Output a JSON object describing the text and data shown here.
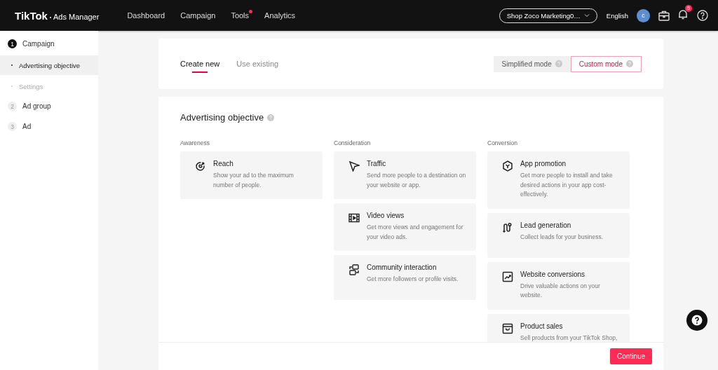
{
  "header": {
    "logo": "TikTok",
    "logo_suffix": "Ads Manager",
    "nav": [
      {
        "label": "Dashboard",
        "badge": false
      },
      {
        "label": "Campaign",
        "badge": false
      },
      {
        "label": "Tools",
        "badge": true
      },
      {
        "label": "Analytics",
        "badge": false
      }
    ],
    "account": "Shop Zoco Marketing0…",
    "language": "English",
    "avatar": "c",
    "notification_count": "5"
  },
  "sidebar": {
    "steps": [
      {
        "number": "1",
        "label": "Campaign",
        "active": true,
        "children": [
          {
            "label": "Advertising objective",
            "selected": true
          },
          {
            "label": "Settings",
            "selected": false
          }
        ]
      },
      {
        "number": "2",
        "label": "Ad group",
        "active": false
      },
      {
        "number": "3",
        "label": "Ad",
        "active": false
      }
    ]
  },
  "tabs": [
    {
      "label": "Create new",
      "selected": true
    },
    {
      "label": "Use existing",
      "selected": false
    }
  ],
  "modes": [
    {
      "label": "Simplified mode",
      "selected": false
    },
    {
      "label": "Custom mode",
      "selected": true
    }
  ],
  "objective": {
    "title": "Advertising objective",
    "groups": [
      {
        "title": "Awareness",
        "options": [
          {
            "title": "Reach",
            "description": "Show your ad to the maximum number of people."
          }
        ]
      },
      {
        "title": "Consideration",
        "options": [
          {
            "title": "Traffic",
            "description": "Send more people to a destination on your website or app."
          },
          {
            "title": "Video views",
            "description": "Get more views and engagement for your video ads."
          },
          {
            "title": "Community interaction",
            "description": "Get more followers or profile visits."
          }
        ]
      },
      {
        "title": "Conversion",
        "options": [
          {
            "title": "App promotion",
            "description": "Get more people to install and take desired actions in your app cost-effectively."
          },
          {
            "title": "Lead generation",
            "description": "Collect leads for your business."
          },
          {
            "title": "Website conversions",
            "description": "Drive valuable actions on your website."
          },
          {
            "title": "Product sales",
            "description": "Sell products from your TikTok Shop,"
          }
        ]
      }
    ]
  },
  "continue_button": "Continue"
}
